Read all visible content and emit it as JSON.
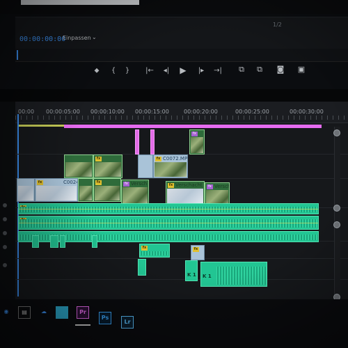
{
  "program": {
    "timecode": "00:00:00:00",
    "fit_label": "Einpassen",
    "fraction": "1/2"
  },
  "ruler": {
    "ticks": [
      "00:00",
      "00:00:05:00",
      "00:00:10:00",
      "00:00:15:00",
      "00:00:20:00",
      "00:00:25:00",
      "00:00:30:00"
    ]
  },
  "clips": {
    "c0_label": "C0024",
    "verschachtelt_1": "Versch",
    "verschachtelt_2": "Verschachtel",
    "verschachtel_3": "Verschacht",
    "c0072": "C0072.MP",
    "k1a": "K 1",
    "k1b": "K 1",
    "fx": "fx"
  },
  "taskbar": {
    "apps": [
      "Pr",
      "Ps",
      "Lr"
    ]
  },
  "colors": {
    "accent_blue": "#3b8ff0",
    "audio_green": "#22c593",
    "nested_green": "#8fd08f",
    "pink": "#e36be8",
    "yellow": "#c9cf58"
  }
}
